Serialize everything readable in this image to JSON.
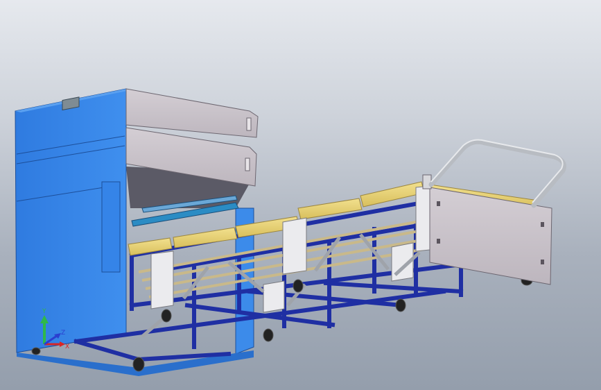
{
  "viewport": {
    "background_top": "#e6e9ee",
    "background_bottom": "#949eac"
  },
  "colors": {
    "cabinet_blue": "#3a86e6",
    "cabinet_blue_dark": "#2a6fcc",
    "frame_navy": "#1f2fa3",
    "cushion_yellow": "#ecd67a",
    "panel_grey": "#c9c2c8",
    "panel_white": "#ebebee",
    "handle_silver": "#c3c6cc"
  },
  "triad": {
    "y_label": "Y",
    "x_label": "X",
    "z_label": "Z",
    "y_color": "#2fb84a",
    "x_color": "#d92626",
    "z_color": "#2a3fd0"
  }
}
